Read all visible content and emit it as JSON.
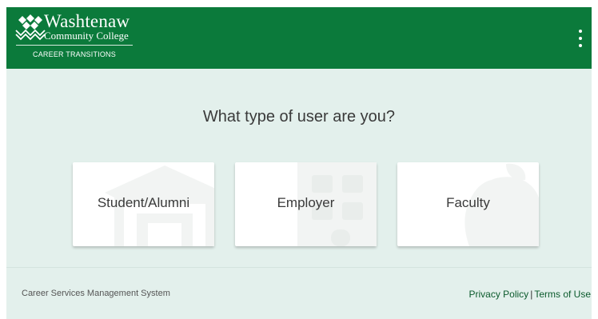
{
  "header": {
    "logo": {
      "title": "Washtenaw",
      "subtitle": "Community College",
      "tagline": "CAREER TRANSITIONS"
    },
    "menu_icon": "more-vertical-icon"
  },
  "main": {
    "question": "What type of user are you?",
    "options": [
      {
        "label": "Student/Alumni",
        "icon": "graduation-cap-icon"
      },
      {
        "label": "Employer",
        "icon": "office-building-icon"
      },
      {
        "label": "Faculty",
        "icon": "apple-icon"
      }
    ]
  },
  "footer": {
    "system_name": "Career Services Management System",
    "privacy_label": "Privacy Policy",
    "separator": "|",
    "terms_label": "Terms of Use"
  },
  "colors": {
    "header_green": "#0b7a3b",
    "background": "#e3f0ec",
    "link_green": "#0b5a2c"
  }
}
